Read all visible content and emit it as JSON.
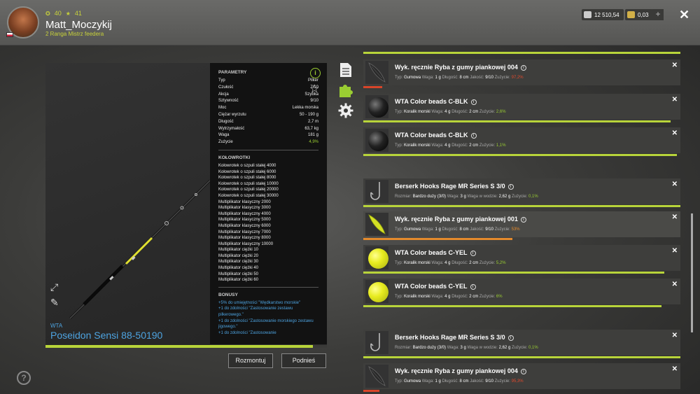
{
  "header": {
    "level": "40",
    "stars": "41",
    "username": "Matt_Moczykij",
    "rank": "2 Ranga Mistrz feedera",
    "silver": "12 510,54",
    "gold": "0,03",
    "plus": "+",
    "close": "✕"
  },
  "rod": {
    "brand": "WTA",
    "name": "Poseidon Sensi 88-50190",
    "wear_fraction": 0.951,
    "params_title": "PARAMETRY",
    "params": [
      {
        "k": "Typ",
        "v": "Pilker"
      },
      {
        "k": "Czułość",
        "v": "7/10"
      },
      {
        "k": "Akcja",
        "v": "Szybka"
      },
      {
        "k": "Sztywność",
        "v": "9/10"
      },
      {
        "k": "Moc",
        "v": "Lekka morska"
      },
      {
        "k": "Ciężar wyrzutu",
        "v": "50 - 190 g"
      },
      {
        "k": "Długość",
        "v": "2,7 m"
      },
      {
        "k": "Wytrzymałość",
        "v": "63,7 kg"
      },
      {
        "k": "Waga",
        "v": "181 g"
      },
      {
        "k": "Zużycie",
        "v": "4,9%"
      }
    ],
    "reels_title": "KOŁOWROTKI",
    "reels": [
      "Kołowrotek o szpuli stałej 4000",
      "Kołowrotek o szpuli stałej 6000",
      "Kołowrotek o szpuli stałej 8000",
      "Kołowrotek o szpuli stałej 10000",
      "Kołowrotek o szpuli stałej 20000",
      "Kołowrotek o szpuli stałej 30000",
      "Multiplikator klasyczny 2000",
      "Multiplikator klasyczny 3000",
      "Multiplikator klasyczny 4000",
      "Multiplikator klasyczny 5000",
      "Multiplikator klasyczny 6000",
      "Multiplikator klasyczny 7000",
      "Multiplikator klasyczny 8000",
      "Multiplikator klasyczny 10000",
      "Multiplikator ciężki 10",
      "Multiplikator ciężki 20",
      "Multiplikator ciężki 30",
      "Multiplikator ciężki 40",
      "Multiplikator ciężki 50",
      "Multiplikator ciężki 60"
    ],
    "bonus_title": "BONUSY",
    "bonuses": [
      "+5% do umiejętności \"Wędkarstwo morskie\"",
      "+1 do zdolności \"Zastosowanie zestawu pilkerowego.\"",
      "+1 do zdolności \"Zastosowanie morskiego zestawu jigowego.\"",
      "+1 do zdolności \"Zastosowanie"
    ]
  },
  "buttons": {
    "dismount": "Rozmontuj",
    "lift": "Podnieś"
  },
  "help": "?",
  "tackle": [
    {
      "title": "Wyk. ręcznie Ryba z gumy piankowej 004",
      "thumb": "fish",
      "parts": [
        [
          "Typ:",
          "Gumowa"
        ],
        [
          "Waga:",
          "1 g"
        ],
        [
          "Długość:",
          "8 cm"
        ],
        [
          "Jakość:",
          "9/10"
        ]
      ],
      "wear_label": "Zużycie:",
      "wear": "97,2%",
      "wear_color": "red",
      "bar": 0.06
    },
    {
      "title": "WTA Color beads C-BLK",
      "thumb": "black",
      "parts": [
        [
          "Typ:",
          "Koralik morski"
        ],
        [
          "Waga:",
          "4 g"
        ],
        [
          "Długość:",
          "2 cm"
        ]
      ],
      "wear_label": "Zużycie:",
      "wear": "2,6%",
      "wear_color": "green",
      "bar": 0.97
    },
    {
      "title": "WTA Color beads C-BLK",
      "thumb": "black",
      "parts": [
        [
          "Typ:",
          "Koralik morski"
        ],
        [
          "Waga:",
          "4 g"
        ],
        [
          "Długość:",
          "2 cm"
        ]
      ],
      "wear_label": "Zużycie:",
      "wear": "1,1%",
      "wear_color": "green",
      "bar": 0.99
    },
    {
      "title": "Berserk Hooks Rage MR Series S 3/0",
      "thumb": "hook",
      "parts": [
        [
          "Rozmiar:",
          "Bardzo duży (3/0)"
        ],
        [
          "Waga:",
          "3 g"
        ],
        [
          "Waga w wodzie:",
          "2,62 g"
        ]
      ],
      "wear_label": "Zużycie:",
      "wear": "0,1%",
      "wear_color": "green",
      "bar": 1.0
    },
    {
      "title": "Wyk. ręcznie Ryba z gumy piankowej 001",
      "thumb": "fish-yellow",
      "parts": [
        [
          "Typ:",
          "Gumowa"
        ],
        [
          "Waga:",
          "1 g"
        ],
        [
          "Długość:",
          "8 cm"
        ],
        [
          "Jakość:",
          "9/10"
        ]
      ],
      "wear_label": "Zużycie:",
      "wear": "53%",
      "wear_color": "orange",
      "bar": 0.47
    },
    {
      "title": "WTA Color beads C-YEL",
      "thumb": "yellow",
      "parts": [
        [
          "Typ:",
          "Koralik morski"
        ],
        [
          "Waga:",
          "4 g"
        ],
        [
          "Długość:",
          "2 cm"
        ]
      ],
      "wear_label": "Zużycie:",
      "wear": "5,2%",
      "wear_color": "green",
      "bar": 0.95
    },
    {
      "title": "WTA Color beads C-YEL",
      "thumb": "yellow",
      "parts": [
        [
          "Typ:",
          "Koralik morski"
        ],
        [
          "Waga:",
          "4 g"
        ],
        [
          "Długość:",
          "2 cm"
        ]
      ],
      "wear_label": "Zużycie:",
      "wear": "6%",
      "wear_color": "green",
      "bar": 0.94
    },
    {
      "title": "Berserk Hooks Rage MR Series S 3/0",
      "thumb": "hook",
      "parts": [
        [
          "Rozmiar:",
          "Bardzo duży (3/0)"
        ],
        [
          "Waga:",
          "3 g"
        ],
        [
          "Waga w wodzie:",
          "2,62 g"
        ]
      ],
      "wear_label": "Zużycie:",
      "wear": "0,1%",
      "wear_color": "green",
      "bar": 1.0
    },
    {
      "title": "Wyk. ręcznie Ryba z gumy piankowej 004",
      "thumb": "fish",
      "parts": [
        [
          "Typ:",
          "Gumowa"
        ],
        [
          "Waga:",
          "1 g"
        ],
        [
          "Długość:",
          "8 cm"
        ],
        [
          "Jakość:",
          "9/10"
        ]
      ],
      "wear_label": "Zużycie:",
      "wear": "95,3%",
      "wear_color": "red",
      "bar": 0.05
    }
  ],
  "icons": [
    "notes-icon",
    "puzzle-icon",
    "gear-icon",
    "info-icon",
    "star-icon",
    "expand-icon",
    "knife-icon",
    "help-icon",
    "close-icon",
    "silver-icon",
    "gold-icon"
  ]
}
